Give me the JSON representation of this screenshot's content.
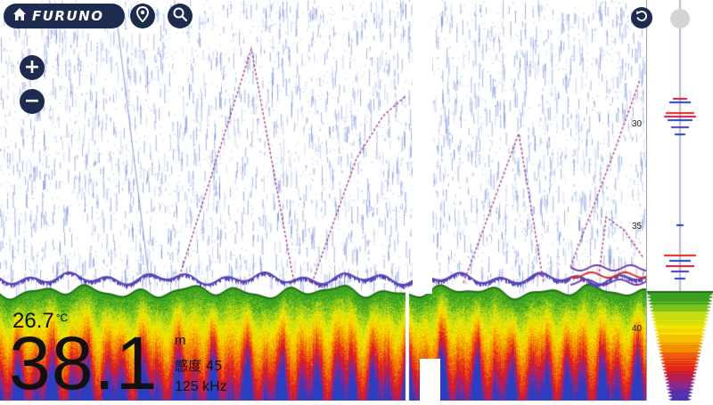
{
  "header": {
    "logo_text": "FURUNO",
    "home_icon": "home-icon",
    "pin_icon": "map-pin-icon",
    "search_icon": "search-icon"
  },
  "zoom": {
    "in_label": "+",
    "out_label": "−"
  },
  "right_controls": {
    "undo_icon": "undo-icon",
    "indicator_icon": "circle-indicator-icon"
  },
  "depth_scale": {
    "labels": [
      "30",
      "35",
      "40"
    ]
  },
  "readouts": {
    "temperature": "26.7",
    "temperature_unit": "°C",
    "depth": "38.1",
    "depth_unit": "m",
    "gain_text": "感度 45",
    "frequency": "125 kHz"
  },
  "colors": {
    "panel_dark": "#1d2b4f",
    "bottom_green": "#3aa020",
    "echo_yellow": "#f2e600",
    "echo_red": "#e3261a",
    "echo_blue": "#2a3ec0"
  }
}
